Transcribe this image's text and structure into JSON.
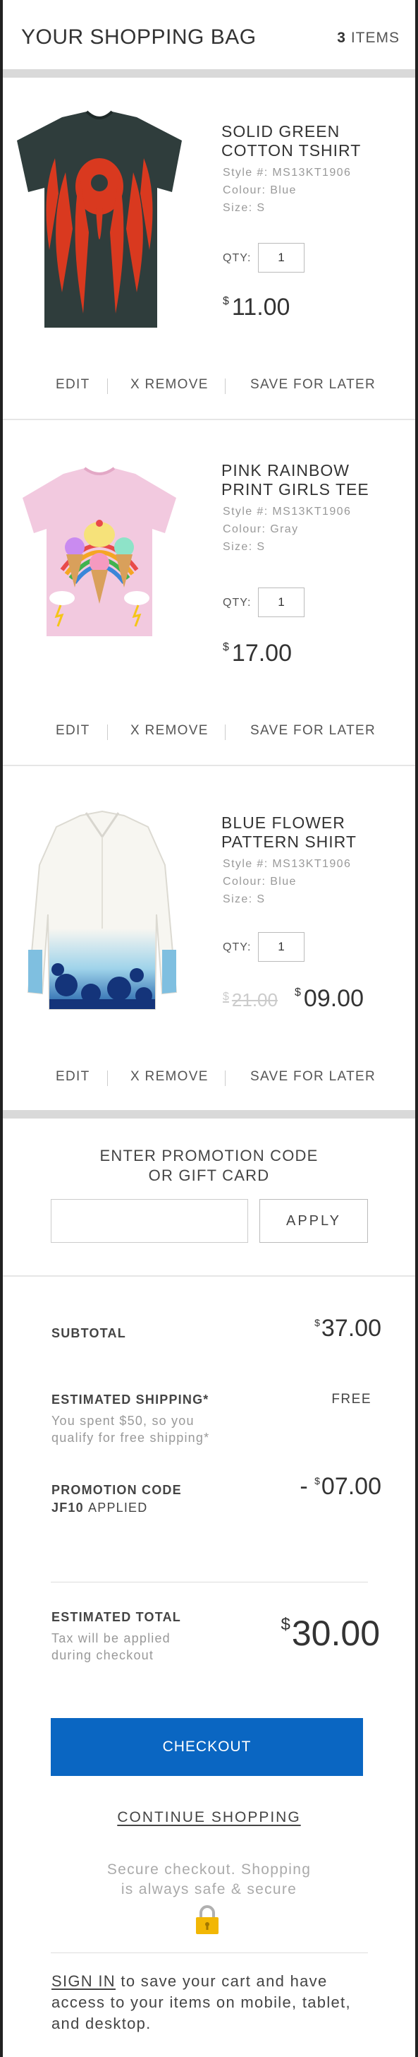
{
  "header": {
    "title": "YOUR SHOPPING BAG",
    "count_number": "3",
    "count_label": "ITEMS"
  },
  "items": [
    {
      "name_line1": "SOLID GREEN",
      "name_line2": "COTTON TSHIRT",
      "style": "Style #: MS13KT1906",
      "colour": "Colour: Blue",
      "size": "Size: S",
      "qty_label": "QTY:",
      "qty": "1",
      "currency": "$",
      "price": "11.00"
    },
    {
      "name_line1": "PINK RAINBOW",
      "name_line2": "PRINT GIRLS TEE",
      "style": "Style #: MS13KT1906",
      "colour": "Colour: Gray",
      "size": "Size: S",
      "qty_label": "QTY:",
      "qty": "1",
      "currency": "$",
      "price": "17.00"
    },
    {
      "name_line1": "BLUE FLOWER",
      "name_line2": "PATTERN SHIRT",
      "style": "Style #: MS13KT1906",
      "colour": "Colour: Blue",
      "size": "Size: S",
      "qty_label": "QTY:",
      "qty": "1",
      "currency": "$",
      "old_price": "21.00",
      "price": "09.00"
    }
  ],
  "actions": {
    "edit": "EDIT",
    "remove": "X REMOVE",
    "save": "SAVE FOR LATER"
  },
  "promo": {
    "line1": "ENTER PROMOTION CODE",
    "line2": "OR GIFT CARD",
    "input_value": "",
    "apply": "APPLY"
  },
  "summary": {
    "subtotal_label": "SUBTOTAL",
    "subtotal_currency": "$",
    "subtotal": "37.00",
    "shipping_label": "ESTIMATED SHIPPING*",
    "shipping_value": "FREE",
    "shipping_note_1": "You spent $50, so you",
    "shipping_note_2": "qualify for free shipping*",
    "promo_label_1": "PROMOTION CODE",
    "promo_code": "JF10",
    "promo_applied": "APPLIED",
    "promo_sign": "- ",
    "promo_currency": "$",
    "promo_value": "07.00",
    "total_label": "ESTIMATED TOTAL",
    "total_note_1": "Tax will be applied",
    "total_note_2": "during checkout",
    "total_currency": "$",
    "total": "30.00"
  },
  "checkout": {
    "label": "CHECKOUT"
  },
  "continue_label": "CONTINUE SHOPPING",
  "secure": {
    "line1": "Secure checkout. Shopping",
    "line2": "is always safe & secure"
  },
  "signin": {
    "link": "SIGN IN",
    "text": " to save your cart and have access to your items on mobile, tablet, and desktop."
  },
  "colors": {
    "accent": "#0a66c2",
    "lock": "#f2b705",
    "divider": "#d9d9d9"
  },
  "icons": [
    "lock-icon"
  ]
}
